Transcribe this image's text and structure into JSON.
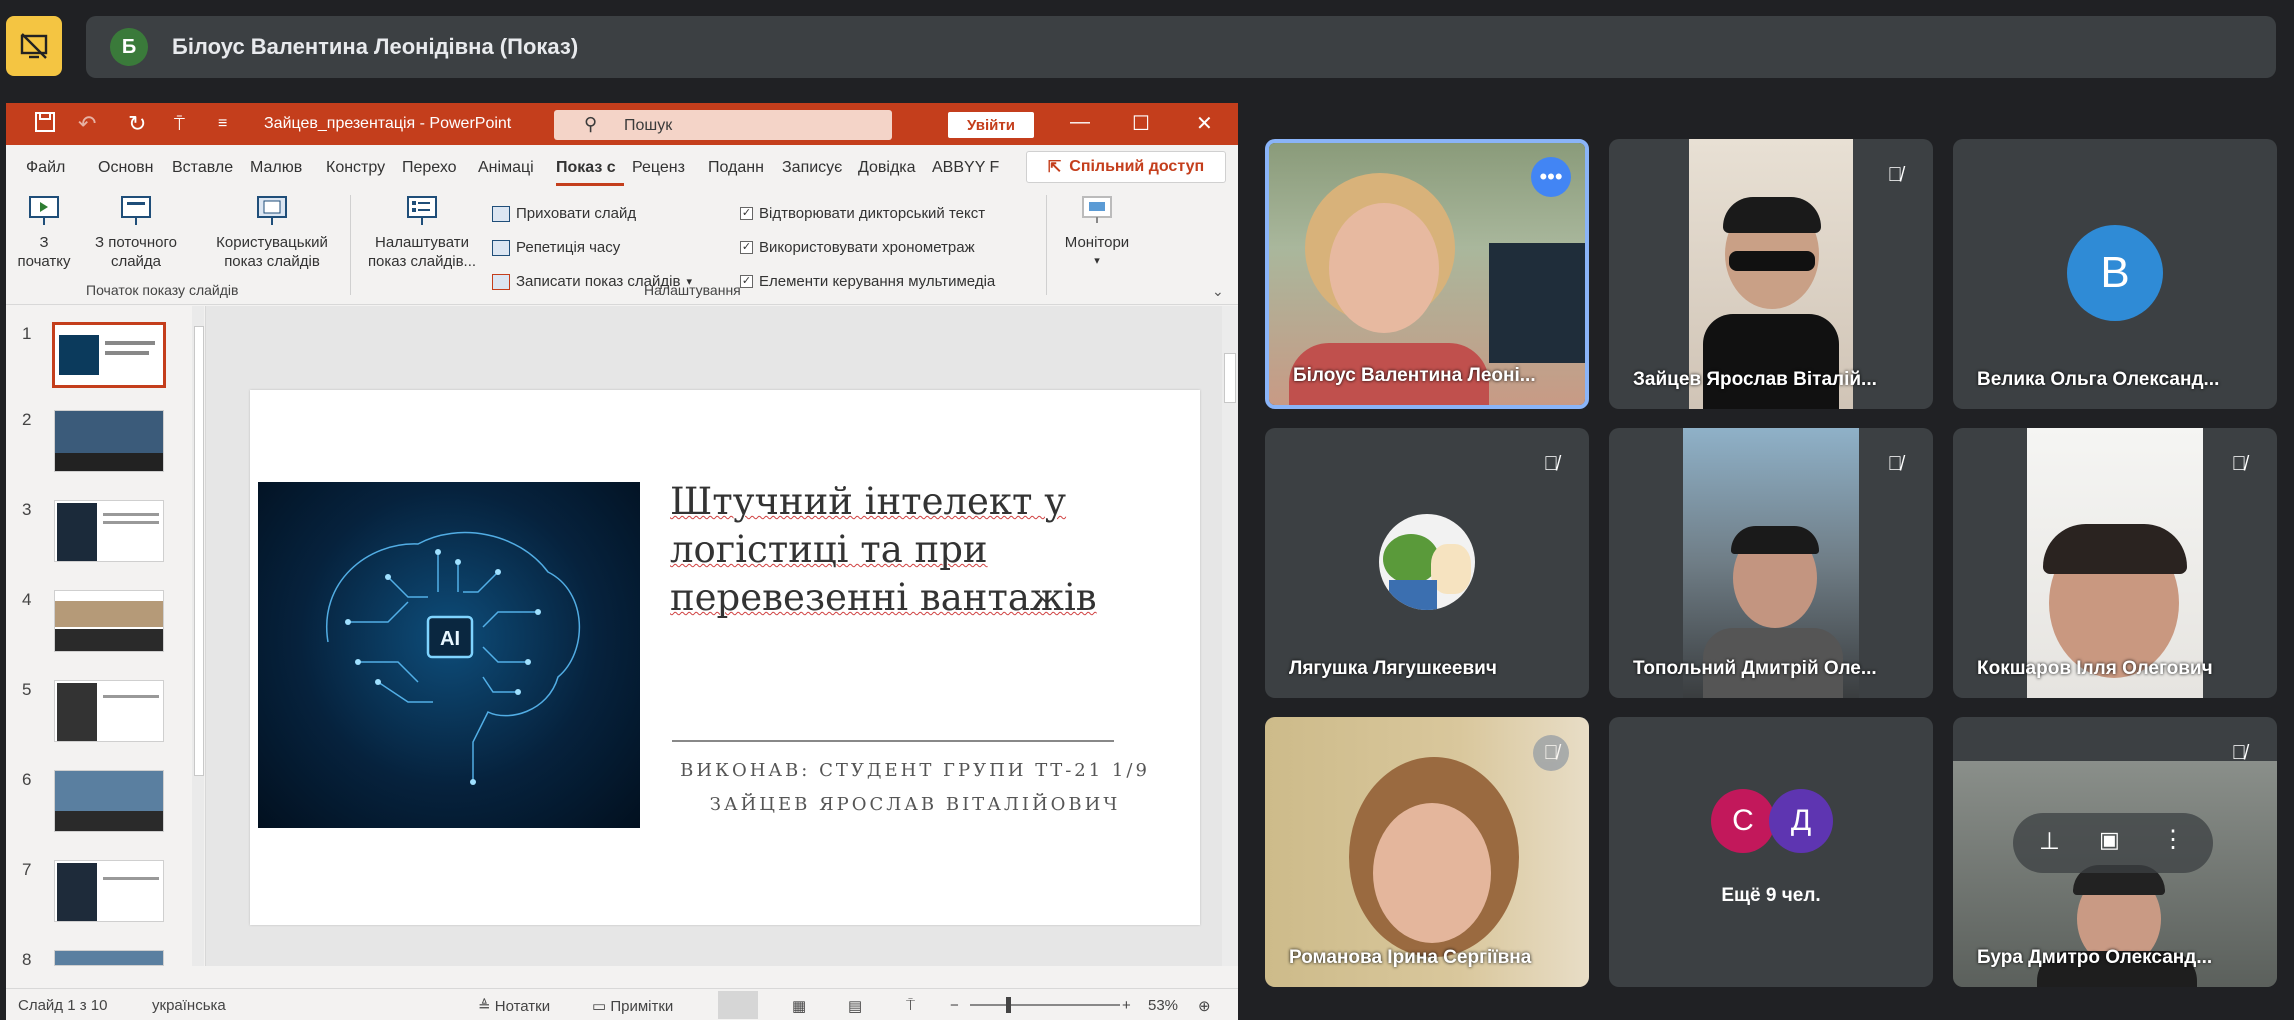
{
  "presenter_bar": {
    "avatar_letter": "Б",
    "title": "Білоус Валентина Леонідівна (Показ)"
  },
  "powerpoint": {
    "doc_title": "Зайцев_презентація  -  PowerPoint",
    "search_placeholder": "Пошук",
    "signin_label": "Увійти",
    "share_label": "Спільний доступ",
    "tabs": [
      "Файл",
      "Основн",
      "Вставле",
      "Малюв",
      "Констру",
      "Перехо",
      "Анімаці",
      "Показ с",
      "Реценз",
      "Поданн",
      "Записує",
      "Довідка",
      "ABBYY F"
    ],
    "active_tab": "Показ с",
    "ribbon": {
      "from_start": "З\nпочатку",
      "from_current": "З поточного\nслайда",
      "custom_show": "Користувацький\nпоказ слайдів",
      "group_start_label": "Початок показу слайдів",
      "setup_show": "Налаштувати\nпоказ слайдів...",
      "hide_slide": "Приховати слайд",
      "rehearse": "Репетиція часу",
      "record": "Записати показ слайдів",
      "play_narrations": "Відтворювати дикторський текст",
      "use_timings": "Використовувати хронометраж",
      "show_media_controls": "Елементи керування мультимедіа",
      "group_setup_label": "Налаштування",
      "monitors": "Монітори"
    },
    "thumbnails": [
      "1",
      "2",
      "3",
      "4",
      "5",
      "6",
      "7",
      "8"
    ],
    "slide": {
      "title": "Штучний інтелект у логістиці та при перевезенні вантажів",
      "ai_badge": "AI",
      "author_line1": "ВИКОНАВ: СТУДЕНТ ГРУПИ ТТ-21 1/9",
      "author_line2": "ЗАЙЦЕВ ЯРОСЛАВ ВІТАЛІЙОВИЧ"
    },
    "status": {
      "slide_count": "Слайд 1 з 10",
      "language": "українська",
      "notes": "Нотатки",
      "comments": "Примітки",
      "zoom": "53%"
    }
  },
  "participants": [
    {
      "name": "Білоус Валентина Леоні...",
      "active": true
    },
    {
      "name": "Зайцев Ярослав Віталій..."
    },
    {
      "name": "Велика Ольга Олександ...",
      "avatar_letter": "В"
    },
    {
      "name": "Лягушка Лягушкеевич"
    },
    {
      "name": "Топольний Дмитрій Оле..."
    },
    {
      "name": "Кокшаров Ілля Олегович"
    },
    {
      "name": "Романова Ірина Сергіївна"
    },
    {
      "name": "Ещё 9 чел.",
      "avatars": [
        "С",
        "Д"
      ]
    },
    {
      "name": "Бура Дмитро Олександ..."
    }
  ],
  "colors": {
    "ppt_accent": "#c43e1c",
    "active_tile_border": "#8ab4f8",
    "avatar_blue": "#2f8bd6",
    "avatar_pink": "#c2185b",
    "avatar_purple": "#5e35b1"
  }
}
